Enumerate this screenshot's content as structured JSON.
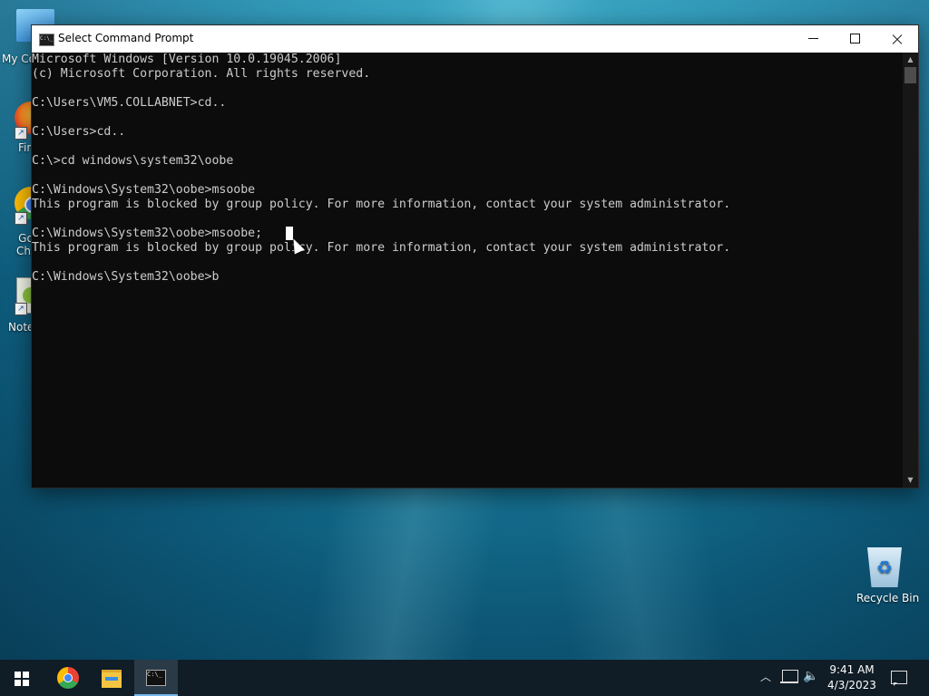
{
  "desktop": {
    "icons": [
      {
        "label": "My Co"
      },
      {
        "label": "Fir"
      },
      {
        "label": "Go\nChr"
      },
      {
        "label": "Note"
      },
      {
        "label": "Recycle Bin"
      }
    ]
  },
  "window": {
    "title": "Select Command Prompt",
    "icon_name": "cmd-icon"
  },
  "console": {
    "lines": [
      "Microsoft Windows [Version 10.0.19045.2006]",
      "(c) Microsoft Corporation. All rights reserved.",
      "",
      "C:\\Users\\VM5.COLLABNET>cd..",
      "",
      "C:\\Users>cd..",
      "",
      "C:\\>cd windows\\system32\\oobe",
      "",
      "C:\\Windows\\System32\\oobe>msoobe",
      "This program is blocked by group policy. For more information, contact your system administrator.",
      "",
      "C:\\Windows\\System32\\oobe>msoobe;",
      "This program is blocked by group policy. For more information, contact your system administrator.",
      "",
      "C:\\Windows\\System32\\oobe>b"
    ]
  },
  "taskbar": {
    "apps": [
      "start-icon",
      "chrome-icon",
      "file-explorer-icon",
      "command-prompt-icon"
    ],
    "clock_time": "9:41 AM",
    "clock_date": "4/3/2023"
  }
}
